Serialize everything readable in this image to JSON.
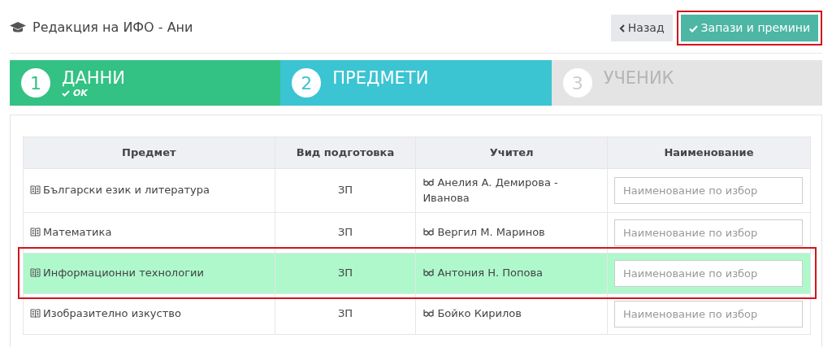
{
  "header": {
    "title": "Редакция на ИФО - Ани"
  },
  "buttons": [
    {
      "label": "Назад",
      "kind": "back",
      "annotated": false
    },
    {
      "label": "Запази и премини",
      "kind": "save",
      "annotated": true
    }
  ],
  "steps": [
    {
      "number": "1",
      "label": "ДАННИ",
      "status": "OK",
      "completed": true,
      "selected": false
    },
    {
      "number": "2",
      "label": "ПРЕДМЕТИ",
      "completed": false,
      "selected": true
    },
    {
      "number": "3",
      "label": "УЧЕНИК",
      "completed": false,
      "selected": false
    }
  ],
  "table": {
    "columns": [
      "Предмет",
      "Вид подготовка",
      "Учител",
      "Наименование"
    ],
    "rows": [
      {
        "subject": "Български език и литература",
        "type": "ЗП",
        "teacher": "Анелия А. Демирова - Иванова",
        "name_placeholder": "Наименование по избор",
        "selected": false,
        "annotated": false
      },
      {
        "subject": "Математика",
        "type": "ЗП",
        "teacher": "Вергил М. Маринов",
        "name_placeholder": "Наименование по избор",
        "selected": false,
        "annotated": false
      },
      {
        "subject": "Информационни технологии",
        "type": "ЗП",
        "teacher": "Антония Н. Попова",
        "name_placeholder": "Наименование по избор",
        "selected": true,
        "annotated": true
      },
      {
        "subject": "Изобразително изкуство",
        "type": "ЗП",
        "teacher": "Бойко Кирилов",
        "name_placeholder": "Наименование по избор",
        "selected": false,
        "annotated": false
      }
    ]
  }
}
